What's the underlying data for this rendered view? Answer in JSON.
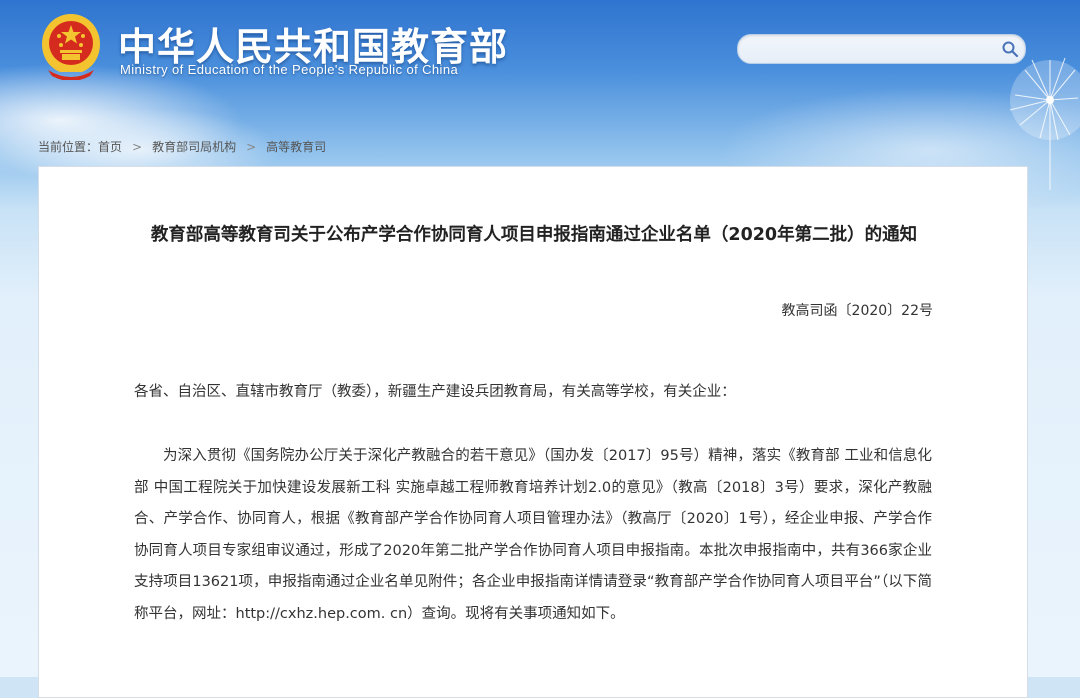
{
  "header": {
    "site_title": "中华人民共和国教育部",
    "site_subtitle": "Ministry of Education of the People's Republic of China"
  },
  "search": {
    "placeholder": "",
    "value": ""
  },
  "breadcrumb": {
    "prefix": "当前位置：",
    "items": [
      "首页",
      "教育部司局机构",
      "高等教育司"
    ]
  },
  "article": {
    "title": "教育部高等教育司关于公布产学合作协同育人项目申报指南通过企业名单（2020年第二批）的通知",
    "doc_number": "教高司函〔2020〕22号",
    "salutation": "各省、自治区、直辖市教育厅（教委），新疆生产建设兵团教育局，有关高等学校，有关企业：",
    "paragraph": "为深入贯彻《国务院办公厅关于深化产教融合的若干意见》（国办发〔2017〕95号）精神，落实《教育部 工业和信息化部 中国工程院关于加快建设发展新工科 实施卓越工程师教育培养计划2.0的意见》（教高〔2018〕3号）要求，深化产教融合、产学合作、协同育人，根据《教育部产学合作协同育人项目管理办法》（教高厅〔2020〕1号），经企业申报、产学合作协同育人项目专家组审议通过，形成了2020年第二批产学合作协同育人项目申报指南。本批次申报指南中，共有366家企业支持项目13621项，申报指南通过企业名单见附件；各企业申报指南详情请登录“教育部产学合作协同育人项目平台”（以下简称平台，网址：http://cxhz.hep.com. cn）查询。现将有关事项通知如下。"
  },
  "icons": {
    "emblem": "national-emblem-icon",
    "search": "search-icon",
    "separator": "chevron-right-icon"
  },
  "colors": {
    "header_blue": "#2f74cf",
    "emblem_red": "#d52b1e",
    "emblem_gold": "#f4c430"
  }
}
